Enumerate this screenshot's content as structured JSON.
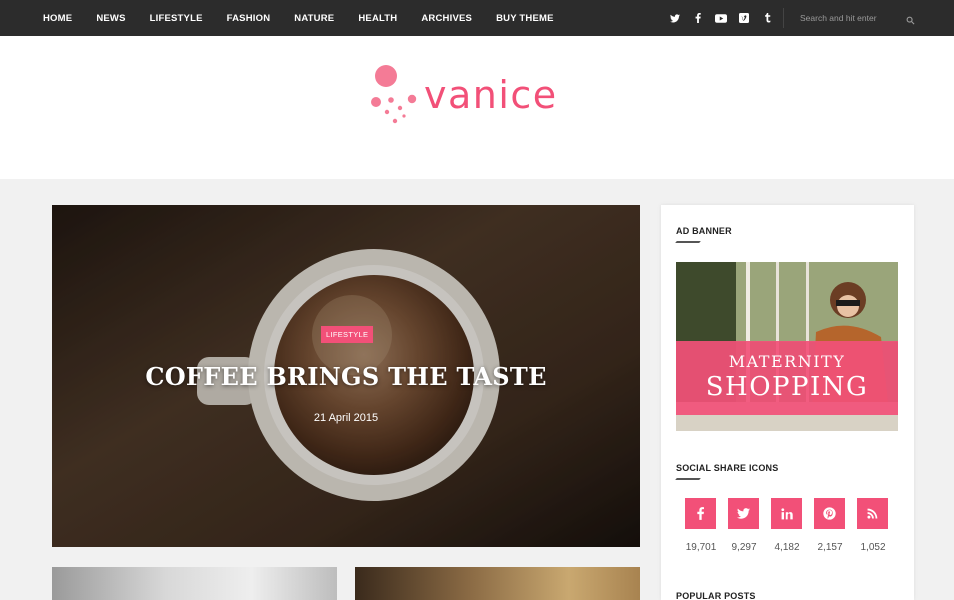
{
  "nav": {
    "items": [
      "HOME",
      "NEWS",
      "LIFESTYLE",
      "FASHION",
      "NATURE",
      "HEALTH",
      "ARCHIVES",
      "BUY THEME"
    ],
    "social_icons": [
      "twitter-icon",
      "facebook-icon",
      "youtube-icon",
      "vimeo-icon",
      "tumblr-icon"
    ],
    "search": {
      "placeholder": "Search and hit enter"
    }
  },
  "header": {
    "logo_text": "vanice"
  },
  "featured": {
    "category": "LIFESTYLE",
    "title": "COFFEE BRINGS THE TASTE",
    "date": "21 April 2015"
  },
  "sidebar": {
    "ad_title": "AD BANNER",
    "ad_line1": "MATERNITY",
    "ad_line2": "SHOPPING",
    "social_title": "SOCIAL SHARE ICONS",
    "social": [
      {
        "icon": "facebook-icon",
        "count": "19,701"
      },
      {
        "icon": "twitter-icon",
        "count": "9,297"
      },
      {
        "icon": "linkedin-icon",
        "count": "4,182"
      },
      {
        "icon": "pinterest-icon",
        "count": "2,157"
      },
      {
        "icon": "rss-icon",
        "count": "1,052"
      }
    ],
    "popular_title": "POPULAR POSTS"
  },
  "colors": {
    "accent": "#f25078",
    "topbar": "#2c2c2c",
    "background": "#f1f1f1"
  }
}
